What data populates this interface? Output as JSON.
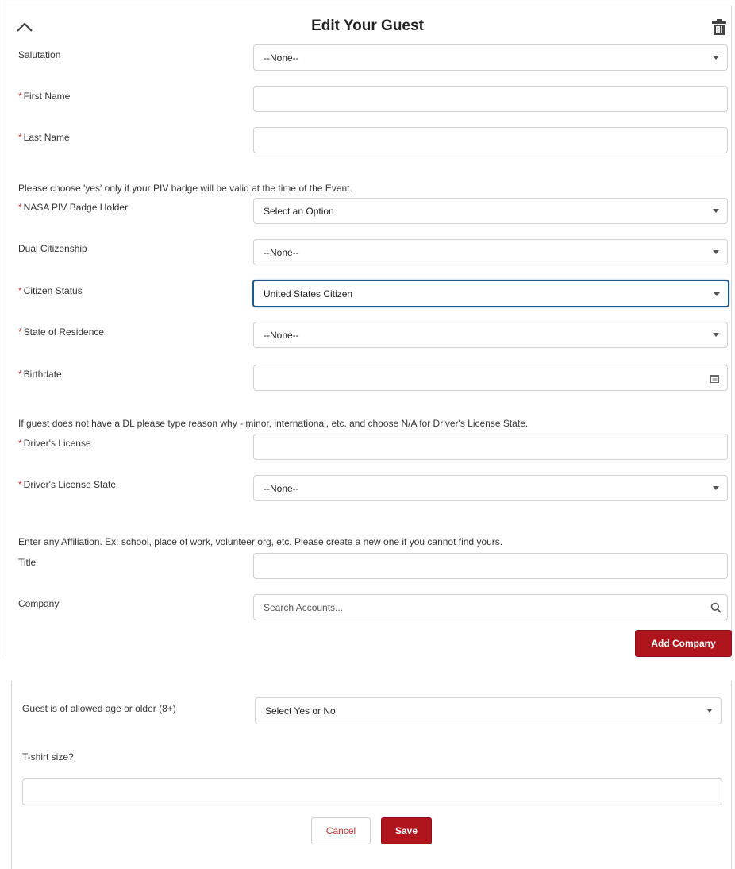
{
  "header": {
    "title": "Edit Your Guest",
    "collapse_icon": "chevron-up-icon",
    "delete_icon": "trash-icon"
  },
  "fields": {
    "salutation": {
      "label": "Salutation",
      "value": "--None--"
    },
    "first_name": {
      "label": "First Name",
      "value": ""
    },
    "last_name": {
      "label": "Last Name",
      "value": ""
    },
    "piv_note": "Please choose 'yes' only if your PIV badge will be valid at the time of the Event.",
    "piv_badge": {
      "label": "NASA PIV Badge Holder",
      "value": "Select an Option"
    },
    "dual_citizenship": {
      "label": "Dual Citizenship",
      "value": "--None--"
    },
    "citizen_status": {
      "label": "Citizen Status",
      "value": "United States Citizen"
    },
    "state_of_residence": {
      "label": "State of Residence",
      "value": "--None--"
    },
    "birthdate": {
      "label": "Birthdate",
      "value": ""
    },
    "dl_note": "If guest does not have a DL please type reason why - minor, international, etc. and choose N/A for Driver's License State.",
    "drivers_license": {
      "label": "Driver's License",
      "value": ""
    },
    "drivers_license_state": {
      "label": "Driver's License State",
      "value": "--None--"
    },
    "affiliation_note": "Enter any Affiliation. Ex: school, place of work, volunteer org, etc. Please create a new one if you cannot find yours.",
    "title_field": {
      "label": "Title",
      "value": ""
    },
    "company": {
      "label": "Company",
      "placeholder": "Search Accounts..."
    },
    "add_company_label": "Add Company",
    "allowed_age": {
      "label": "Guest is of allowed age or older (8+)",
      "value": "Select Yes or No"
    },
    "tshirt": {
      "label": "T-shirt size?",
      "value": ""
    }
  },
  "footer": {
    "cancel_label": "Cancel",
    "save_label": "Save"
  },
  "colors": {
    "primary_red": "#b0151e",
    "required_star": "#c23934",
    "focus_blue": "#1b5a8c"
  }
}
